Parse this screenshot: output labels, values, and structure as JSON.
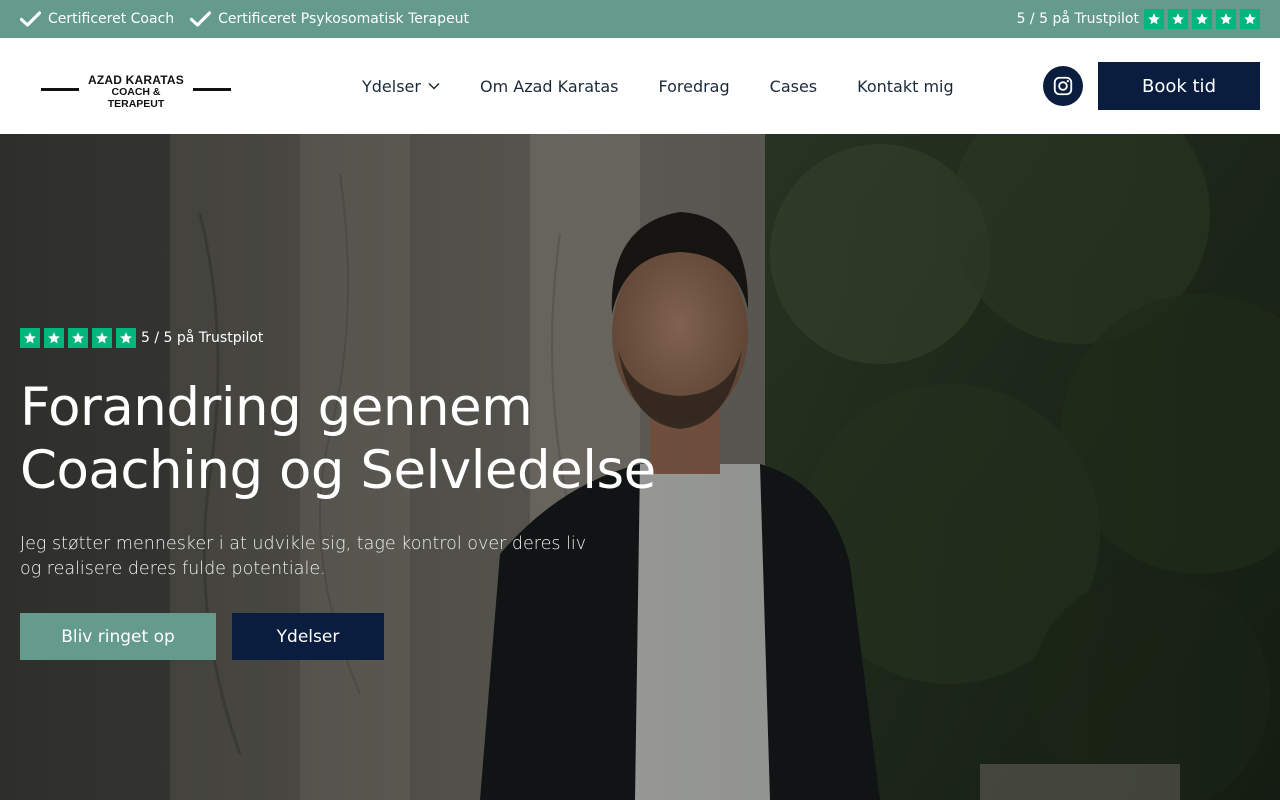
{
  "colors": {
    "topbar": "#649b8c",
    "navy": "#0b1d3f",
    "trustpilot_green": "#00b67a",
    "accent_teal": "#649b8c"
  },
  "topbar": {
    "certifications": [
      "Certificeret Coach",
      "Certificeret Psykosomatisk Terapeut"
    ],
    "trustpilot_text": "5 / 5 på Trustpilot",
    "rating_stars": 5
  },
  "header": {
    "logo": {
      "name": "AZAD KARATAS",
      "tagline": "COACH & TERAPEUT"
    },
    "nav": [
      {
        "label": "Ydelser",
        "has_dropdown": true
      },
      {
        "label": "Om Azad Karatas",
        "has_dropdown": false
      },
      {
        "label": "Foredrag",
        "has_dropdown": false
      },
      {
        "label": "Cases",
        "has_dropdown": false
      },
      {
        "label": "Kontakt mig",
        "has_dropdown": false
      }
    ],
    "social_icon": "instagram-icon",
    "book_label": "Book tid"
  },
  "hero": {
    "trustpilot_text": "5 / 5 på Trustpilot",
    "rating_stars": 5,
    "title_line1": "Forandring gennem",
    "title_line2": "Coaching og Selvledelse",
    "subtitle": "Jeg støtter mennesker i at udvikle sig, tage kontrol over deres liv og realisere deres fulde potentiale.",
    "primary_cta": "Bliv ringet op",
    "secondary_cta": "Ydelser"
  }
}
